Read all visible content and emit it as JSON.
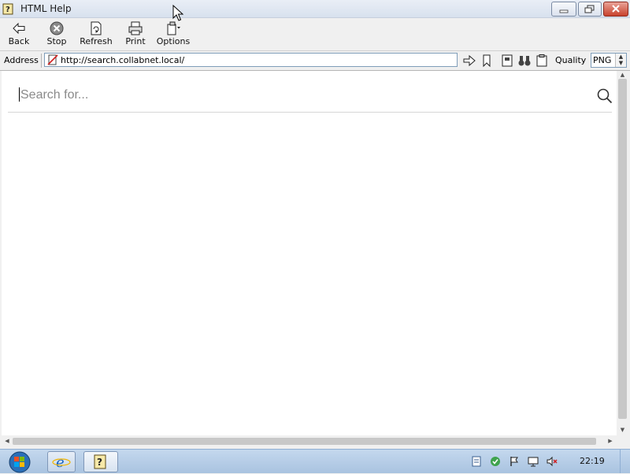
{
  "window": {
    "title": "HTML Help",
    "controls": [
      "minimize",
      "maximize",
      "close"
    ]
  },
  "toolbar": {
    "buttons": [
      {
        "label": "Back",
        "icon": "back-arrow-icon"
      },
      {
        "label": "Stop",
        "icon": "stop-icon"
      },
      {
        "label": "Refresh",
        "icon": "refresh-icon"
      },
      {
        "label": "Print",
        "icon": "printer-icon"
      },
      {
        "label": "Options",
        "icon": "options-icon"
      }
    ]
  },
  "address_bar": {
    "label": "Address",
    "url": "http://search.collabnet.local/",
    "quality_label": "Quality",
    "quality_value": "PNG"
  },
  "content": {
    "search_placeholder": "Search for..."
  },
  "taskbar": {
    "clock": "22:19"
  },
  "colors": {
    "titlebar": "#dbe3ef",
    "taskbar": "#b6cce6",
    "close_button": "#c8412c"
  }
}
